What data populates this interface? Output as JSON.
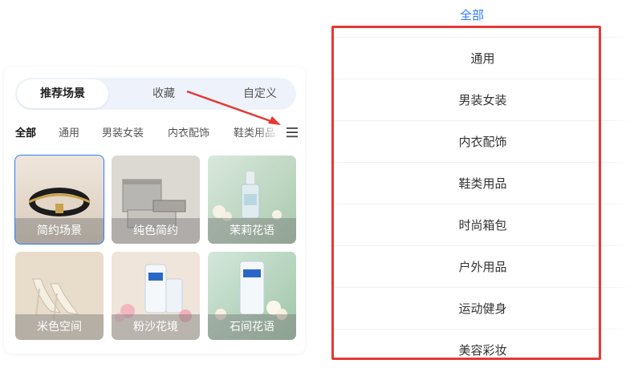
{
  "tabs": [
    "推荐场景",
    "收藏",
    "自定义"
  ],
  "categories": [
    "全部",
    "通用",
    "男装女装",
    "内衣配饰",
    "鞋类用品"
  ],
  "scenes": [
    {
      "label": "简约场景"
    },
    {
      "label": "纯色简约"
    },
    {
      "label": "茉莉花语"
    },
    {
      "label": "米色空间"
    },
    {
      "label": "粉沙花境"
    },
    {
      "label": "石间花语"
    }
  ],
  "dropdown": {
    "all_label": "全部",
    "items": [
      "通用",
      "男装女装",
      "内衣配饰",
      "鞋类用品",
      "时尚箱包",
      "户外用品",
      "运动健身",
      "美容彩妆"
    ]
  },
  "colors": {
    "accent": "#2f7bff",
    "highlight": "#e53935"
  }
}
